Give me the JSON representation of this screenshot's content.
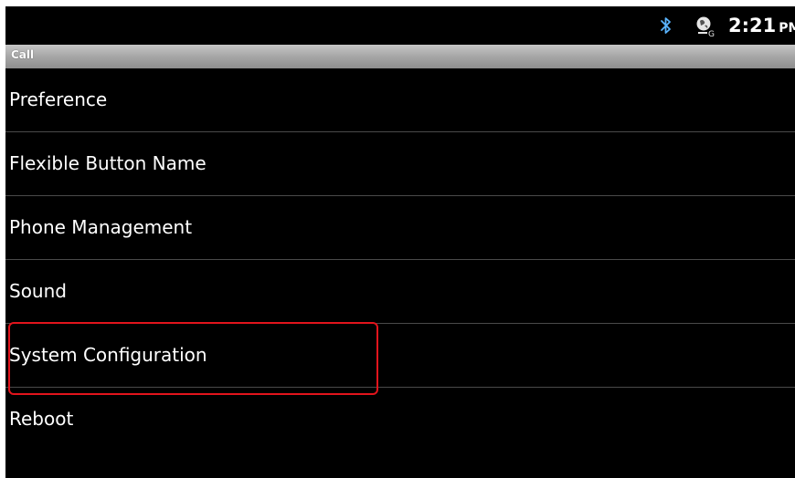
{
  "status_bar": {
    "time": "2:21",
    "ampm": "PM",
    "icons": [
      "bluetooth-icon",
      "gps-icon"
    ]
  },
  "title_bar": {
    "title": "Call"
  },
  "menu": {
    "items": [
      {
        "label": "Preference"
      },
      {
        "label": "Flexible Button Name"
      },
      {
        "label": "Phone Management"
      },
      {
        "label": "Sound"
      },
      {
        "label": "System Configuration",
        "highlighted": true
      },
      {
        "label": "Reboot"
      }
    ]
  },
  "colors": {
    "background": "#000000",
    "text": "#ffffff",
    "divider": "#4a4a4a",
    "highlight": "#e2141c"
  }
}
